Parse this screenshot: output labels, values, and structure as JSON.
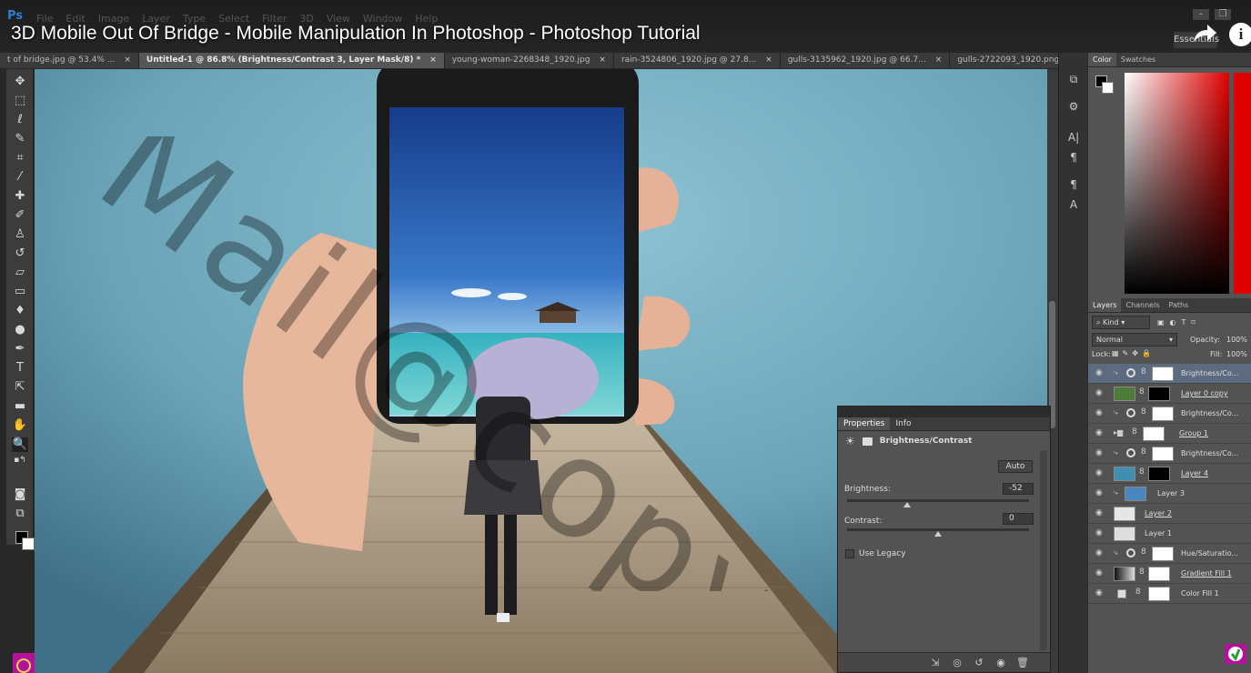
{
  "app": {
    "logo": "Ps",
    "menus": [
      "File",
      "Edit",
      "Image",
      "Layer",
      "Type",
      "Select",
      "Filter",
      "3D",
      "View",
      "Window",
      "Help"
    ],
    "video_title": "3D Mobile Out Of Bridge - Mobile Manipulation In Photoshop - Photoshop Tutorial",
    "workspace": "Essentials"
  },
  "tabs": [
    {
      "label": "t of bridge.jpg @ 53.4% ...",
      "active": false
    },
    {
      "label": "Untitled-1 @ 86.8% (Brightness/Contrast 3, Layer Mask/8) *",
      "active": true
    },
    {
      "label": "young-woman-2268348_1920.jpg",
      "active": false
    },
    {
      "label": "rain-3524806_1920.jpg @ 27.8...",
      "active": false
    },
    {
      "label": "gulls-3135962_1920.jpg @ 66.7...",
      "active": false
    },
    {
      "label": "gulls-2722093_1920.png @ 66....",
      "active": false
    }
  ],
  "tools": [
    "move-tool",
    "marquee-tool",
    "lasso-tool",
    "quick-select-tool",
    "crop-tool",
    "eyedropper-tool",
    "healing-tool",
    "brush-tool",
    "stamp-tool",
    "history-brush-tool",
    "eraser-tool",
    "gradient-tool",
    "blur-tool",
    "dodge-tool",
    "pen-tool",
    "type-tool",
    "path-select-tool",
    "shape-tool",
    "hand-tool",
    "zoom-tool"
  ],
  "properties": {
    "tabs": [
      "Properties",
      "Info"
    ],
    "title": "Brightness/Contrast",
    "auto_label": "Auto",
    "brightness_label": "Brightness:",
    "brightness_value": "-52",
    "contrast_label": "Contrast:",
    "contrast_value": "0",
    "legacy_label": "Use Legacy"
  },
  "color_panel": {
    "tabs": [
      "Color",
      "Swatches"
    ]
  },
  "layers_panel": {
    "tabs": [
      "Layers",
      "Channels",
      "Paths"
    ],
    "kind_label": "Kind",
    "blend_mode": "Normal",
    "opacity_label": "Opacity:",
    "opacity_value": "100%",
    "lock_label": "Lock:",
    "fill_label": "Fill:",
    "fill_value": "100%",
    "layers": [
      {
        "name": "Brightness/Co...",
        "selected": true
      },
      {
        "name": "Layer 0 copy",
        "selected": false
      },
      {
        "name": "Brightness/Co...",
        "selected": false
      },
      {
        "name": "Group 1",
        "selected": false
      },
      {
        "name": "Brightness/Co...",
        "selected": false
      },
      {
        "name": "Layer 4",
        "selected": false
      },
      {
        "name": "Layer 3",
        "selected": false
      },
      {
        "name": "Layer 2",
        "selected": false
      },
      {
        "name": "Layer 1",
        "selected": false
      },
      {
        "name": "Hue/Saturatio...",
        "selected": false
      },
      {
        "name": "Gradient Fill 1",
        "selected": false
      },
      {
        "name": "Color Fill 1",
        "selected": false
      }
    ]
  },
  "watermark": "Mail@copy",
  "colors": {
    "accent": "#2d7fd1",
    "canvas_bg": "#6aa3b8",
    "selected_layer": "#5d6b80"
  },
  "adjustment_state": {
    "brightness_fraction": 0.33,
    "contrast_fraction": 0.5
  }
}
